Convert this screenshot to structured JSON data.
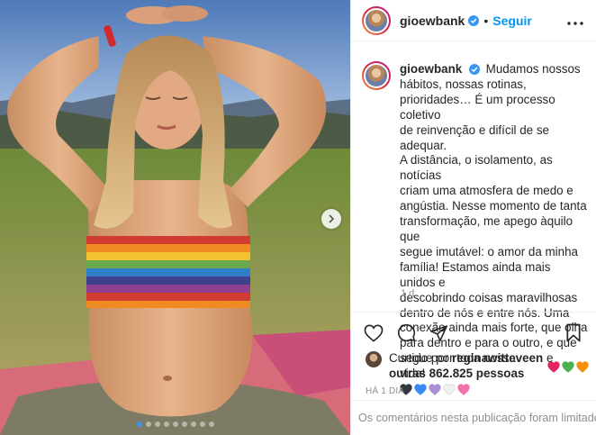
{
  "post": {
    "username": "gioewbank",
    "follow_label": "Seguir",
    "bullet": "•",
    "caption": {
      "lines": [
        "Mudamos nossos",
        "hábitos, nossas rotinas,",
        "prioridades… É um processo coletivo",
        "de reinvenção e difícil de se adequar.",
        "A distância, o isolamento, as notícias",
        "criam uma atmosfera de medo e",
        "angústia. Nesse momento de tanta",
        "transformação, me apego àquilo que",
        "segue imutável: o amor da minha",
        "família! Estamos ainda mais unidos e",
        "descobrindo coisas maravilhosas",
        "dentro de nós e entre nós. Uma",
        "conexão ainda mais forte, que olha",
        "para dentro e para o outro, e que",
        "segue por toda nossa vida!"
      ],
      "emoji_hearts_inline": [
        "#e0245e",
        "#4caf50",
        "#f4900c"
      ],
      "emoji_hearts_row": [
        "#31373d",
        "#3b88f5",
        "#aa8ed6",
        "#f0f0f0",
        "#f470a9"
      ],
      "time": "1 d"
    },
    "liked": {
      "prefix": "Curtido por",
      "user": "reginawitteveen",
      "conjunction": "e",
      "others": "outras 862.825 pessoas"
    },
    "posted_ago": "HÁ 1 DIA",
    "comments_limited": "Os comentários nesta publicação foram limitados.",
    "carousel": {
      "slides": 9,
      "active_index": 0
    },
    "colors": {
      "accent": "#0095f6",
      "verified": "#3897f0",
      "muted": "#8e8e8e"
    },
    "icons": [
      "more-options-icon",
      "heart-icon",
      "comment-icon",
      "share-icon",
      "bookmark-icon",
      "verified-badge-icon",
      "next-arrow-icon"
    ]
  }
}
